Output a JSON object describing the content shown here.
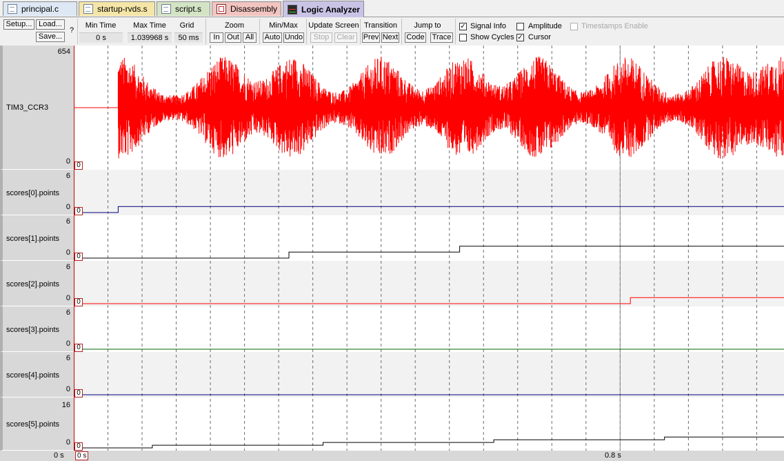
{
  "tabs": [
    {
      "label": "principal.c",
      "icon": "c-file-icon",
      "bg": "#dde8f4"
    },
    {
      "label": "startup-rvds.s",
      "icon": "asm-file-icon",
      "bg": "#f5e6a8"
    },
    {
      "label": "script.s",
      "icon": "script-file-icon",
      "bg": "#d3e4c4"
    },
    {
      "label": "Disassembly",
      "icon": "disassembly-icon",
      "bg": "#f2c4c0"
    },
    {
      "label": "Logic Analyzer",
      "icon": "logic-analyzer-icon",
      "bg": "#c9c3e6"
    }
  ],
  "toolbar": {
    "setup": "Setup...",
    "load": "Load...",
    "save": "Save...",
    "help": "?",
    "min_time_label": "Min Time",
    "min_time_value": "0 s",
    "max_time_label": "Max Time",
    "max_time_value": "1.039968 s",
    "grid_label": "Grid",
    "grid_value": "50 ms",
    "zoom_label": "Zoom",
    "zoom_in": "In",
    "zoom_out": "Out",
    "zoom_all": "All",
    "minmax_label": "Min/Max",
    "minmax_auto": "Auto",
    "minmax_undo": "Undo",
    "update_label": "Update Screen",
    "update_stop": "Stop",
    "update_clear": "Clear",
    "transition_label": "Transition",
    "trans_prev": "Prev",
    "trans_next": "Next",
    "jump_label": "Jump to",
    "jump_code": "Code",
    "jump_trace": "Trace",
    "signal_info": "Signal Info",
    "signal_info_checked": true,
    "show_cycles": "Show Cycles",
    "show_cycles_checked": false,
    "amplitude": "Amplitude",
    "amplitude_checked": false,
    "cursor": "Cursor",
    "cursor_checked": true,
    "timestamps": "Timestamps Enable",
    "timestamps_checked": false
  },
  "signals": [
    {
      "name": "TIM3_CCR3",
      "max": "654",
      "min": "0",
      "cursor_value": "0",
      "color": "#ff0000"
    },
    {
      "name": "scores[0].points",
      "max": "6",
      "min": "0",
      "cursor_value": "0",
      "color": "#000080"
    },
    {
      "name": "scores[1].points",
      "max": "6",
      "min": "0",
      "cursor_value": "0",
      "color": "#000000"
    },
    {
      "name": "scores[2].points",
      "max": "6",
      "min": "0",
      "cursor_value": "0",
      "color": "#ff0000"
    },
    {
      "name": "scores[3].points",
      "max": "6",
      "min": "0",
      "cursor_value": "0",
      "color": "#006400"
    },
    {
      "name": "scores[4].points",
      "max": "6",
      "min": "0",
      "cursor_value": "0",
      "color": "#000080"
    },
    {
      "name": "scores[5].points",
      "max": "16",
      "min": "0",
      "cursor_value": "0",
      "color": "#000000"
    }
  ],
  "time_axis": {
    "start": "0 s",
    "cursor": "0 s",
    "marker": "0.8 s",
    "grid_ms": 50,
    "max_s": 1.039968
  },
  "chart_data": {
    "type": "line",
    "x_unit": "s",
    "xlim": [
      0,
      1.039968
    ],
    "grid_s": 0.05,
    "cursor_x": 0.8,
    "series": [
      {
        "name": "TIM3_CCR3",
        "ylim": [
          0,
          654
        ],
        "initial": 327,
        "noise_start": 0.065,
        "envelope_peaks": [
          0.07,
          0.22,
          0.32,
          0.45,
          0.57,
          0.68,
          0.81,
          0.95,
          1.035
        ]
      },
      {
        "name": "scores[0].points",
        "ylim": [
          0,
          6
        ],
        "steps": [
          [
            0,
            0
          ],
          [
            0.065,
            1
          ]
        ]
      },
      {
        "name": "scores[1].points",
        "ylim": [
          0,
          6
        ],
        "steps": [
          [
            0,
            0
          ],
          [
            0.315,
            1
          ],
          [
            0.565,
            2
          ]
        ]
      },
      {
        "name": "scores[2].points",
        "ylim": [
          0,
          6
        ],
        "steps": [
          [
            0,
            0
          ],
          [
            0.815,
            1
          ]
        ]
      },
      {
        "name": "scores[3].points",
        "ylim": [
          0,
          6
        ],
        "steps": [
          [
            0,
            0
          ]
        ]
      },
      {
        "name": "scores[4].points",
        "ylim": [
          0,
          6
        ],
        "steps": [
          [
            0,
            0
          ]
        ]
      },
      {
        "name": "scores[5].points",
        "ylim": [
          0,
          16
        ],
        "steps": [
          [
            0,
            0
          ],
          [
            0.115,
            1
          ],
          [
            0.365,
            2
          ],
          [
            0.615,
            3
          ],
          [
            0.865,
            4
          ]
        ]
      }
    ]
  }
}
